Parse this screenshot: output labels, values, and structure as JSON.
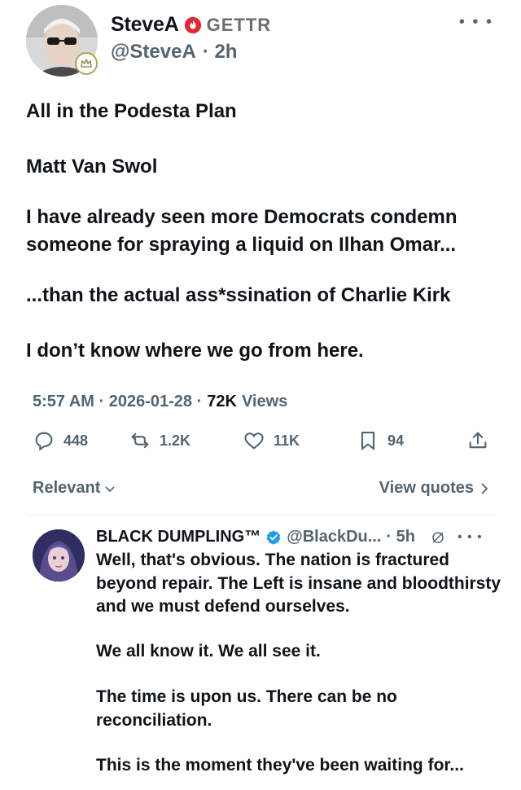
{
  "post": {
    "author_name": "SteveA",
    "platform_label": "GETTR",
    "handle": "@SteveA",
    "time_ago": "· 2h",
    "more_icon": "more-horizontal-icon",
    "paragraphs": [
      "All in the Podesta Plan",
      "Matt Van Swol",
      "I have already seen more Democrats condemn someone for spraying a liquid on Ilhan Omar...",
      "...than the actual ass*ssination of Charlie Kirk",
      "I don’t know where we go from here."
    ],
    "timestamp": "5:57 AM · 2026-01-28 ·",
    "views_count": "72K",
    "views_label": "Views",
    "actions": {
      "replies": "448",
      "reposts": "1.2K",
      "likes": "11K",
      "bookmarks": "94"
    },
    "sort_label": "Relevant",
    "view_quotes_label": "View quotes"
  },
  "reply": {
    "author_name": "BLACK DUMPLING™",
    "handle": "@BlackDu...",
    "time_ago": "· 5h",
    "paragraphs": [
      "Well, that's obvious. The nation is fractured beyond repair. The Left is insane and bloodthirsty and we must defend ourselves.",
      "We all know it. We all see it.",
      "The time is upon us. There can be no reconciliation.",
      "This is the moment they've been waiting for..."
    ]
  },
  "colors": {
    "text": "#0f1419",
    "secondary": "#536471",
    "gettr_red": "#e8262f",
    "verified_blue": "#1d9bf0",
    "divider": "#e6e8ea"
  }
}
